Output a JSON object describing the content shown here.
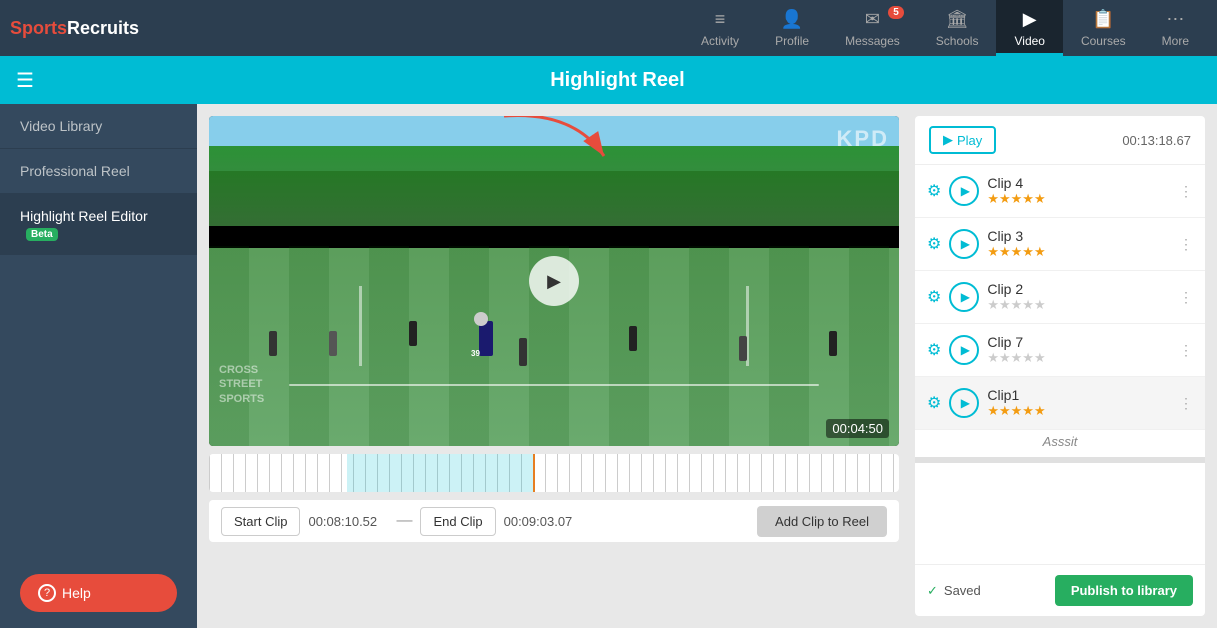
{
  "app": {
    "logo_sports": "Sports",
    "logo_recruits": "Recruits"
  },
  "nav": {
    "items": [
      {
        "id": "activity",
        "label": "Activity",
        "icon": "≡",
        "badge": null,
        "active": false
      },
      {
        "id": "profile",
        "label": "Profile",
        "icon": "👤",
        "badge": null,
        "active": false
      },
      {
        "id": "messages",
        "label": "Messages",
        "icon": "✉",
        "badge": "5",
        "active": false
      },
      {
        "id": "schools",
        "label": "Schools",
        "icon": "🏛",
        "badge": null,
        "active": false
      },
      {
        "id": "video",
        "label": "Video",
        "icon": "▶",
        "badge": null,
        "active": true
      },
      {
        "id": "courses",
        "label": "Courses",
        "icon": "≡",
        "badge": null,
        "active": false
      },
      {
        "id": "more",
        "label": "More",
        "icon": "⋯",
        "badge": null,
        "active": false
      }
    ]
  },
  "subheader": {
    "title": "Highlight Reel"
  },
  "sidebar": {
    "items": [
      {
        "id": "video-library",
        "label": "Video Library",
        "active": false
      },
      {
        "id": "professional-reel",
        "label": "Professional Reel",
        "active": false
      },
      {
        "id": "highlight-reel-editor",
        "label": "Highlight Reel Editor",
        "badge": "Beta",
        "active": true
      }
    ],
    "help_label": "Help"
  },
  "video": {
    "time_display": "00:04:50"
  },
  "controls": {
    "start_clip_label": "Start Clip",
    "start_time": "00:08:10.52",
    "end_clip_label": "End Clip",
    "end_time": "00:09:03.07",
    "add_clip_label": "Add Clip to Reel"
  },
  "panel": {
    "play_label": "Play",
    "total_time": "00:13:18.67",
    "clips": [
      {
        "id": "clip4",
        "name": "Clip 4",
        "stars": 5,
        "selected": false
      },
      {
        "id": "clip3",
        "name": "Clip 3",
        "stars": 5,
        "selected": false
      },
      {
        "id": "clip2",
        "name": "Clip 2",
        "stars": 0,
        "selected": false
      },
      {
        "id": "clip7",
        "name": "Clip 7",
        "stars": 0,
        "selected": false
      },
      {
        "id": "clip1",
        "name": "Clip1",
        "stars": 5,
        "selected": true,
        "tag": "Asssit"
      }
    ],
    "saved_label": "Saved",
    "publish_label": "Publish to library"
  }
}
